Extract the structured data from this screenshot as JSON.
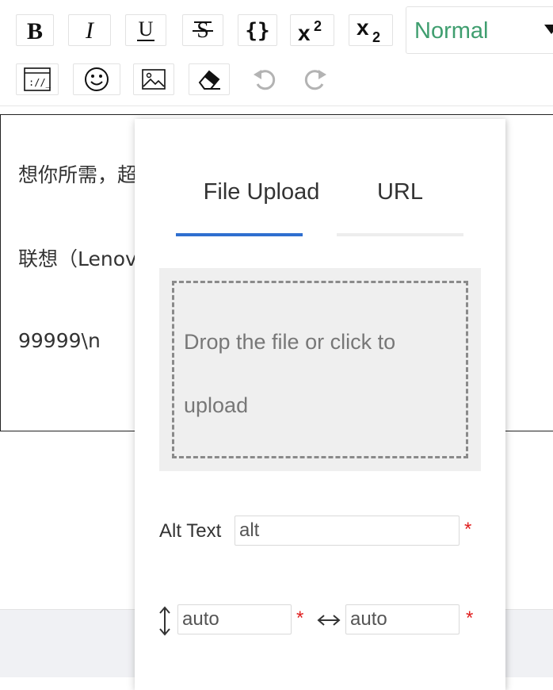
{
  "toolbar": {
    "buttons_row1": [
      {
        "name": "bold",
        "tooltip": ""
      },
      {
        "name": "italic"
      },
      {
        "name": "underline"
      },
      {
        "name": "strikethrough"
      },
      {
        "name": "code"
      },
      {
        "name": "superscript"
      },
      {
        "name": "subscript"
      }
    ],
    "format_select": {
      "value": "Normal"
    },
    "buttons_row2": [
      {
        "name": "html-source"
      },
      {
        "name": "emoji"
      },
      {
        "name": "image"
      },
      {
        "name": "clear-format"
      },
      {
        "name": "undo",
        "disabled": true
      },
      {
        "name": "redo",
        "disabled": true
      }
    ]
  },
  "editor": {
    "lines": [
      "想你所需，超你所想！精致外观，轻薄便携带，内置",
      "联想（Lenovo）ThinkPad E系列 轻薄商务",
      "99999\\n"
    ]
  },
  "image_popup": {
    "tabs": [
      {
        "label": "File Upload",
        "active": true
      },
      {
        "label": "URL",
        "active": false
      }
    ],
    "dropzone_text": "Drop the file or click to upload",
    "alt_label": "Alt Text",
    "alt_value": "alt",
    "height_value": "auto",
    "width_value": "auto",
    "required_mark": "*"
  },
  "colors": {
    "accent": "#2f6fd0",
    "select_text": "#3f9e6f",
    "required": "#e02020"
  }
}
